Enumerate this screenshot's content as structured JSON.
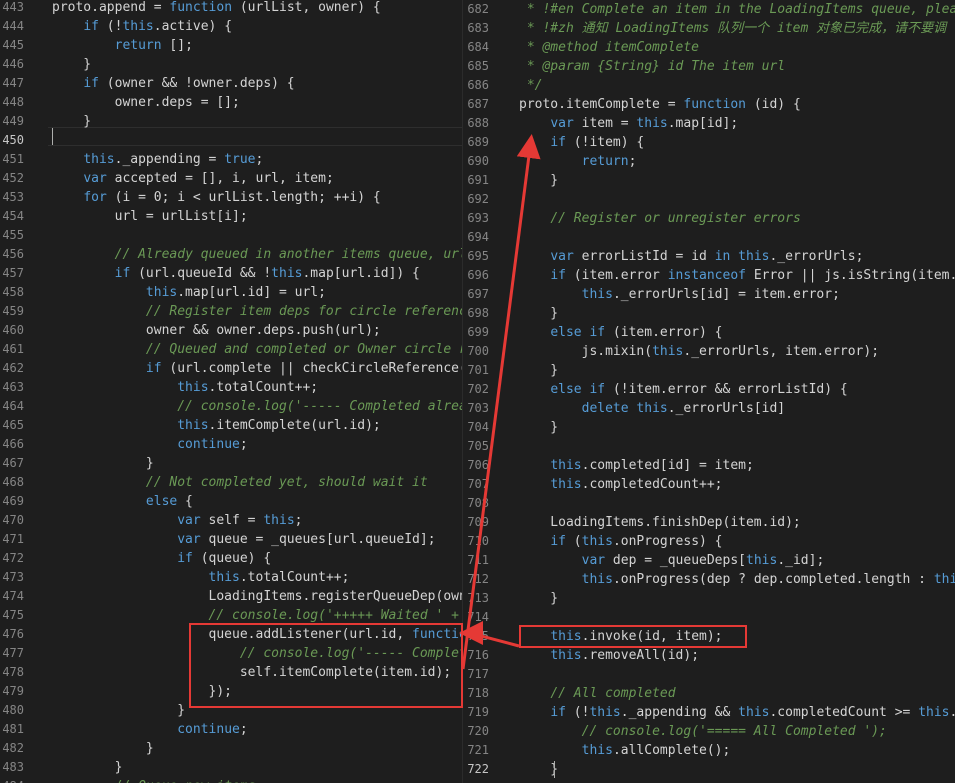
{
  "left_pane": {
    "first_line": 443,
    "lines": [
      [
        {
          "t": "proto.append = ",
          "c": "id"
        },
        {
          "t": "function",
          "c": "kw"
        },
        {
          "t": " (urlList, owner) {",
          "c": "id"
        }
      ],
      [
        {
          "t": "    ",
          "c": "id"
        },
        {
          "t": "if",
          "c": "kw"
        },
        {
          "t": " (!",
          "c": "id"
        },
        {
          "t": "this",
          "c": "kw"
        },
        {
          "t": ".active) {",
          "c": "id"
        }
      ],
      [
        {
          "t": "        ",
          "c": "id"
        },
        {
          "t": "return",
          "c": "kw"
        },
        {
          "t": " [];",
          "c": "id"
        }
      ],
      [
        {
          "t": "    }",
          "c": "id"
        }
      ],
      [
        {
          "t": "    ",
          "c": "id"
        },
        {
          "t": "if",
          "c": "kw"
        },
        {
          "t": " (owner && !owner.deps) {",
          "c": "id"
        }
      ],
      [
        {
          "t": "        owner.deps = [];",
          "c": "id"
        }
      ],
      [
        {
          "t": "    }",
          "c": "id"
        }
      ],
      [
        {
          "t": "",
          "c": "id"
        }
      ],
      [
        {
          "t": "    ",
          "c": "id"
        },
        {
          "t": "this",
          "c": "kw"
        },
        {
          "t": "._appending = ",
          "c": "id"
        },
        {
          "t": "true",
          "c": "kw"
        },
        {
          "t": ";",
          "c": "id"
        }
      ],
      [
        {
          "t": "    ",
          "c": "id"
        },
        {
          "t": "var",
          "c": "kw"
        },
        {
          "t": " accepted = [], i, url, item;",
          "c": "id"
        }
      ],
      [
        {
          "t": "    ",
          "c": "id"
        },
        {
          "t": "for",
          "c": "kw"
        },
        {
          "t": " (i = 0; i < urlList.length; ++i) {",
          "c": "id"
        }
      ],
      [
        {
          "t": "        url = urlList[i];",
          "c": "id"
        }
      ],
      [
        {
          "t": "",
          "c": "id"
        }
      ],
      [
        {
          "t": "        ",
          "c": "id"
        },
        {
          "t": "// Already queued in another items queue, url",
          "c": "com"
        }
      ],
      [
        {
          "t": "        ",
          "c": "id"
        },
        {
          "t": "if",
          "c": "kw"
        },
        {
          "t": " (url.queueId && !",
          "c": "id"
        },
        {
          "t": "this",
          "c": "kw"
        },
        {
          "t": ".map[url.id]) {",
          "c": "id"
        }
      ],
      [
        {
          "t": "            ",
          "c": "id"
        },
        {
          "t": "this",
          "c": "kw"
        },
        {
          "t": ".map[url.id] = url;",
          "c": "id"
        }
      ],
      [
        {
          "t": "            ",
          "c": "id"
        },
        {
          "t": "// Register item deps for circle reference",
          "c": "com"
        }
      ],
      [
        {
          "t": "            owner && owner.deps.push(url);",
          "c": "id"
        }
      ],
      [
        {
          "t": "            ",
          "c": "id"
        },
        {
          "t": "// Queued and completed or Owner circle re",
          "c": "com"
        }
      ],
      [
        {
          "t": "            ",
          "c": "id"
        },
        {
          "t": "if",
          "c": "kw"
        },
        {
          "t": " (url.complete || checkCircleReference(o",
          "c": "id"
        }
      ],
      [
        {
          "t": "                ",
          "c": "id"
        },
        {
          "t": "this",
          "c": "kw"
        },
        {
          "t": ".totalCount++;",
          "c": "id"
        }
      ],
      [
        {
          "t": "                ",
          "c": "id"
        },
        {
          "t": "// console.log('----- Completed alread",
          "c": "com"
        }
      ],
      [
        {
          "t": "                ",
          "c": "id"
        },
        {
          "t": "this",
          "c": "kw"
        },
        {
          "t": ".itemComplete(url.id);",
          "c": "id"
        }
      ],
      [
        {
          "t": "                ",
          "c": "id"
        },
        {
          "t": "continue",
          "c": "kw"
        },
        {
          "t": ";",
          "c": "id"
        }
      ],
      [
        {
          "t": "            }",
          "c": "id"
        }
      ],
      [
        {
          "t": "            ",
          "c": "id"
        },
        {
          "t": "// Not completed yet, should wait it",
          "c": "com"
        }
      ],
      [
        {
          "t": "            ",
          "c": "id"
        },
        {
          "t": "else",
          "c": "kw"
        },
        {
          "t": " {",
          "c": "id"
        }
      ],
      [
        {
          "t": "                ",
          "c": "id"
        },
        {
          "t": "var",
          "c": "kw"
        },
        {
          "t": " self = ",
          "c": "id"
        },
        {
          "t": "this",
          "c": "kw"
        },
        {
          "t": ";",
          "c": "id"
        }
      ],
      [
        {
          "t": "                ",
          "c": "id"
        },
        {
          "t": "var",
          "c": "kw"
        },
        {
          "t": " queue = _queues[url.queueId];",
          "c": "id"
        }
      ],
      [
        {
          "t": "                ",
          "c": "id"
        },
        {
          "t": "if",
          "c": "kw"
        },
        {
          "t": " (queue) {",
          "c": "id"
        }
      ],
      [
        {
          "t": "                    ",
          "c": "id"
        },
        {
          "t": "this",
          "c": "kw"
        },
        {
          "t": ".totalCount++;",
          "c": "id"
        }
      ],
      [
        {
          "t": "                    LoadingItems.registerQueueDep(owne",
          "c": "id"
        }
      ],
      [
        {
          "t": "                    ",
          "c": "id"
        },
        {
          "t": "// console.log('+++++ Waited ' + (",
          "c": "com"
        }
      ],
      [
        {
          "t": "                    queue.addListener(url.id, ",
          "c": "id"
        },
        {
          "t": "functio",
          "c": "kw"
        }
      ],
      [
        {
          "t": "                        ",
          "c": "id"
        },
        {
          "t": "// console.log('----- Complet",
          "c": "com"
        }
      ],
      [
        {
          "t": "                        self.itemComplete(item.id);",
          "c": "id"
        }
      ],
      [
        {
          "t": "                    });",
          "c": "id"
        }
      ],
      [
        {
          "t": "                }",
          "c": "id"
        }
      ],
      [
        {
          "t": "                ",
          "c": "id"
        },
        {
          "t": "continue",
          "c": "kw"
        },
        {
          "t": ";",
          "c": "id"
        }
      ],
      [
        {
          "t": "            }",
          "c": "id"
        }
      ],
      [
        {
          "t": "        }",
          "c": "id"
        }
      ],
      [
        {
          "t": "        ",
          "c": "id"
        },
        {
          "t": "// Queue new items",
          "c": "com"
        }
      ]
    ]
  },
  "right_pane": {
    "first_line": 682,
    "lines": [
      [
        {
          "t": " * !#en Complete an item in the LoadingItems queue, pleas",
          "c": "com"
        }
      ],
      [
        {
          "t": " * !#zh 通知 LoadingItems 队列一个 item 对象已完成，请不要调",
          "c": "com"
        }
      ],
      [
        {
          "t": " * @method itemComplete",
          "c": "com"
        }
      ],
      [
        {
          "t": " * @param {String} id The item url",
          "c": "com"
        }
      ],
      [
        {
          "t": " */",
          "c": "com"
        }
      ],
      [
        {
          "t": "proto.itemComplete = ",
          "c": "id"
        },
        {
          "t": "function",
          "c": "kw"
        },
        {
          "t": " (id) {",
          "c": "id"
        }
      ],
      [
        {
          "t": "    ",
          "c": "id"
        },
        {
          "t": "var",
          "c": "kw"
        },
        {
          "t": " item = ",
          "c": "id"
        },
        {
          "t": "this",
          "c": "kw"
        },
        {
          "t": ".map[id];",
          "c": "id"
        }
      ],
      [
        {
          "t": "    ",
          "c": "id"
        },
        {
          "t": "if",
          "c": "kw"
        },
        {
          "t": " (!item) {",
          "c": "id"
        }
      ],
      [
        {
          "t": "        ",
          "c": "id"
        },
        {
          "t": "return",
          "c": "kw"
        },
        {
          "t": ";",
          "c": "id"
        }
      ],
      [
        {
          "t": "    }",
          "c": "id"
        }
      ],
      [
        {
          "t": "",
          "c": "id"
        }
      ],
      [
        {
          "t": "    ",
          "c": "id"
        },
        {
          "t": "// Register or unregister errors",
          "c": "com"
        }
      ],
      [
        {
          "t": "",
          "c": "id"
        }
      ],
      [
        {
          "t": "    ",
          "c": "id"
        },
        {
          "t": "var",
          "c": "kw"
        },
        {
          "t": " errorListId = id ",
          "c": "id"
        },
        {
          "t": "in",
          "c": "kw"
        },
        {
          "t": " ",
          "c": "id"
        },
        {
          "t": "this",
          "c": "kw"
        },
        {
          "t": "._errorUrls;",
          "c": "id"
        }
      ],
      [
        {
          "t": "    ",
          "c": "id"
        },
        {
          "t": "if",
          "c": "kw"
        },
        {
          "t": " (item.error ",
          "c": "id"
        },
        {
          "t": "instanceof",
          "c": "kw"
        },
        {
          "t": " Error || js.isString(item.e",
          "c": "id"
        }
      ],
      [
        {
          "t": "        ",
          "c": "id"
        },
        {
          "t": "this",
          "c": "kw"
        },
        {
          "t": "._errorUrls[id] = item.error;",
          "c": "id"
        }
      ],
      [
        {
          "t": "    }",
          "c": "id"
        }
      ],
      [
        {
          "t": "    ",
          "c": "id"
        },
        {
          "t": "else if",
          "c": "kw"
        },
        {
          "t": " (item.error) {",
          "c": "id"
        }
      ],
      [
        {
          "t": "        js.mixin(",
          "c": "id"
        },
        {
          "t": "this",
          "c": "kw"
        },
        {
          "t": "._errorUrls, item.error);",
          "c": "id"
        }
      ],
      [
        {
          "t": "    }",
          "c": "id"
        }
      ],
      [
        {
          "t": "    ",
          "c": "id"
        },
        {
          "t": "else if",
          "c": "kw"
        },
        {
          "t": " (!item.error && errorListId) {",
          "c": "id"
        }
      ],
      [
        {
          "t": "        ",
          "c": "id"
        },
        {
          "t": "delete",
          "c": "kw"
        },
        {
          "t": " ",
          "c": "id"
        },
        {
          "t": "this",
          "c": "kw"
        },
        {
          "t": "._errorUrls[id]",
          "c": "id"
        }
      ],
      [
        {
          "t": "    }",
          "c": "id"
        }
      ],
      [
        {
          "t": "",
          "c": "id"
        }
      ],
      [
        {
          "t": "    ",
          "c": "id"
        },
        {
          "t": "this",
          "c": "kw"
        },
        {
          "t": ".completed[id] = item;",
          "c": "id"
        }
      ],
      [
        {
          "t": "    ",
          "c": "id"
        },
        {
          "t": "this",
          "c": "kw"
        },
        {
          "t": ".completedCount++;",
          "c": "id"
        }
      ],
      [
        {
          "t": "",
          "c": "id"
        }
      ],
      [
        {
          "t": "    LoadingItems.finishDep(item.id);",
          "c": "id"
        }
      ],
      [
        {
          "t": "    ",
          "c": "id"
        },
        {
          "t": "if",
          "c": "kw"
        },
        {
          "t": " (",
          "c": "id"
        },
        {
          "t": "this",
          "c": "kw"
        },
        {
          "t": ".onProgress) {",
          "c": "id"
        }
      ],
      [
        {
          "t": "        ",
          "c": "id"
        },
        {
          "t": "var",
          "c": "kw"
        },
        {
          "t": " dep = _queueDeps[",
          "c": "id"
        },
        {
          "t": "this",
          "c": "kw"
        },
        {
          "t": "._id];",
          "c": "id"
        }
      ],
      [
        {
          "t": "        ",
          "c": "id"
        },
        {
          "t": "this",
          "c": "kw"
        },
        {
          "t": ".onProgress(dep ? dep.completed.length : ",
          "c": "id"
        },
        {
          "t": "this",
          "c": "kw"
        }
      ],
      [
        {
          "t": "    }",
          "c": "id"
        }
      ],
      [
        {
          "t": "",
          "c": "id"
        }
      ],
      [
        {
          "t": "    ",
          "c": "id"
        },
        {
          "t": "this",
          "c": "kw"
        },
        {
          "t": ".invoke(id, item);",
          "c": "id"
        }
      ],
      [
        {
          "t": "    ",
          "c": "id"
        },
        {
          "t": "this",
          "c": "kw"
        },
        {
          "t": ".removeAll(id);",
          "c": "id"
        }
      ],
      [
        {
          "t": "",
          "c": "id"
        }
      ],
      [
        {
          "t": "    ",
          "c": "id"
        },
        {
          "t": "// All completed",
          "c": "com"
        }
      ],
      [
        {
          "t": "    ",
          "c": "id"
        },
        {
          "t": "if",
          "c": "kw"
        },
        {
          "t": " (!",
          "c": "id"
        },
        {
          "t": "this",
          "c": "kw"
        },
        {
          "t": "._appending && ",
          "c": "id"
        },
        {
          "t": "this",
          "c": "kw"
        },
        {
          "t": ".completedCount >= ",
          "c": "id"
        },
        {
          "t": "this",
          "c": "kw"
        },
        {
          "t": ".t",
          "c": "id"
        }
      ],
      [
        {
          "t": "        ",
          "c": "id"
        },
        {
          "t": "// console.log('===== All Completed ');",
          "c": "com"
        }
      ],
      [
        {
          "t": "        ",
          "c": "id"
        },
        {
          "t": "this",
          "c": "kw"
        },
        {
          "t": ".allComplete();",
          "c": "id"
        }
      ],
      [
        {
          "t": "    }",
          "c": "id"
        }
      ]
    ]
  },
  "colors": {
    "background": "#1e1e1e",
    "keyword": "#569cd6",
    "comment": "#6a9955",
    "identifier": "#d4d4d4",
    "line_number": "#858585",
    "annotation": "#e53935"
  }
}
